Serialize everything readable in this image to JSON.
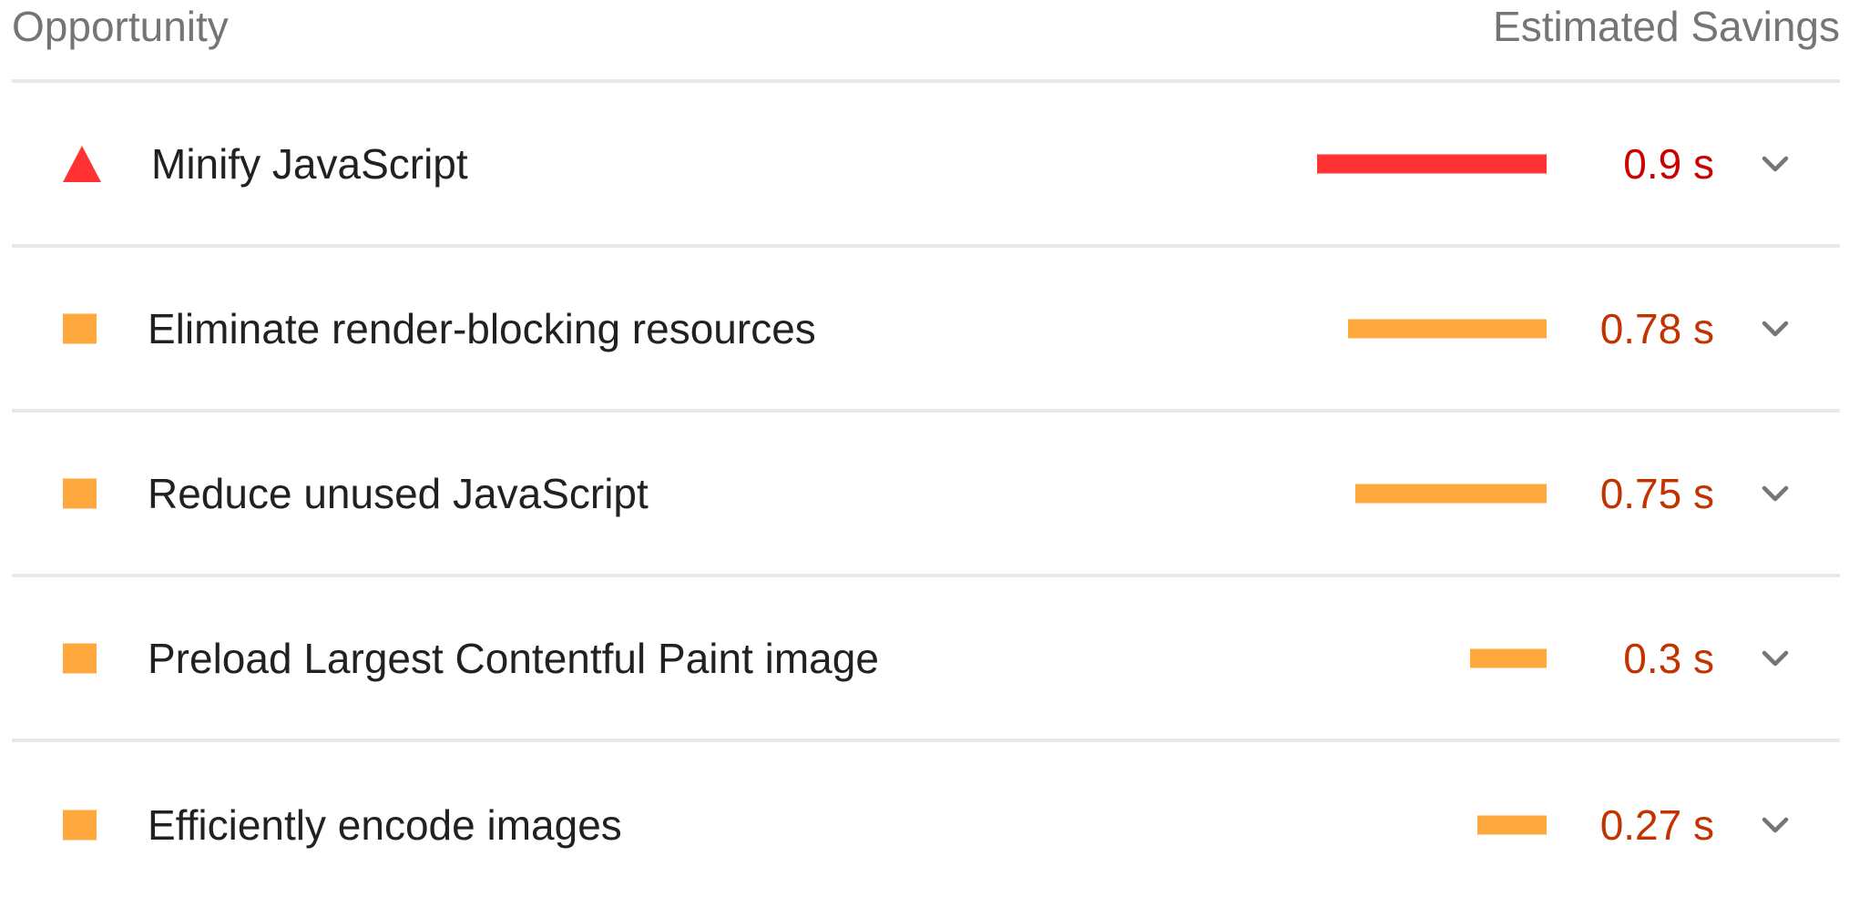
{
  "header": {
    "left_label": "Opportunity",
    "right_label": "Estimated Savings"
  },
  "colors": {
    "fail": "#ff3333",
    "fail_text": "#cc0000",
    "average": "#ffa83e",
    "average_text": "#c33300",
    "chevron": "#757575"
  },
  "opportunities": [
    {
      "title": "Minify JavaScript",
      "savings": "0.9 s",
      "savings_seconds": 0.9,
      "rating": "fail",
      "icon": "triangle-icon"
    },
    {
      "title": "Eliminate render-blocking resources",
      "savings": "0.78 s",
      "savings_seconds": 0.78,
      "rating": "average",
      "icon": "square-icon"
    },
    {
      "title": "Reduce unused JavaScript",
      "savings": "0.75 s",
      "savings_seconds": 0.75,
      "rating": "average",
      "icon": "square-icon"
    },
    {
      "title": "Preload Largest Contentful Paint image",
      "savings": "0.3 s",
      "savings_seconds": 0.3,
      "rating": "average",
      "icon": "square-icon"
    },
    {
      "title": "Efficiently encode images",
      "savings": "0.27 s",
      "savings_seconds": 0.27,
      "rating": "average",
      "icon": "square-icon"
    }
  ]
}
